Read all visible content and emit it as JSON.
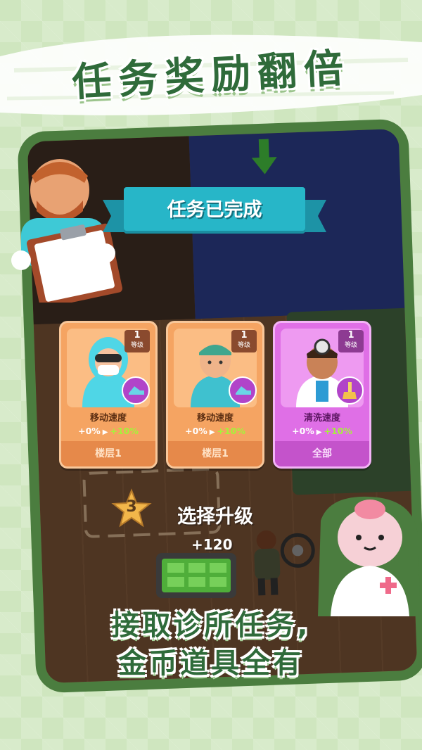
{
  "headline": "任务奖励翻倍",
  "banner": {
    "text": "任务已完成"
  },
  "cards": [
    {
      "level_num": "1",
      "level_label": "等级",
      "title": "移动速度",
      "stat_from": "+0%",
      "stat_to": "+10%",
      "footer": "楼层1",
      "icon": "speed-shoe-icon",
      "portrait": "hazmat-worker-portrait"
    },
    {
      "level_num": "1",
      "level_label": "等级",
      "title": "移动速度",
      "stat_from": "+0%",
      "stat_to": "+10%",
      "footer": "楼层1",
      "icon": "speed-shoe-icon",
      "portrait": "nurse-portrait"
    },
    {
      "level_num": "1",
      "level_label": "等级",
      "title": "清洗速度",
      "stat_from": "+0%",
      "stat_to": "+10%",
      "footer": "全部",
      "icon": "cleaning-brush-icon",
      "portrait": "doctor-portrait"
    }
  ],
  "game": {
    "select_upgrade": "选择升级",
    "coin_gain": "+120",
    "star_level": "3"
  },
  "tagline": {
    "line1": "接取诊所任务,",
    "line2": "金币道具全有"
  },
  "colors": {
    "background": "#cfe6bf",
    "frame": "#4b7d3f",
    "banner": "#27b6c8",
    "card_orange": "#f5a462",
    "card_purple": "#df6fe6",
    "stat_up": "#a5f23a",
    "headline": "#2f6b3a"
  }
}
